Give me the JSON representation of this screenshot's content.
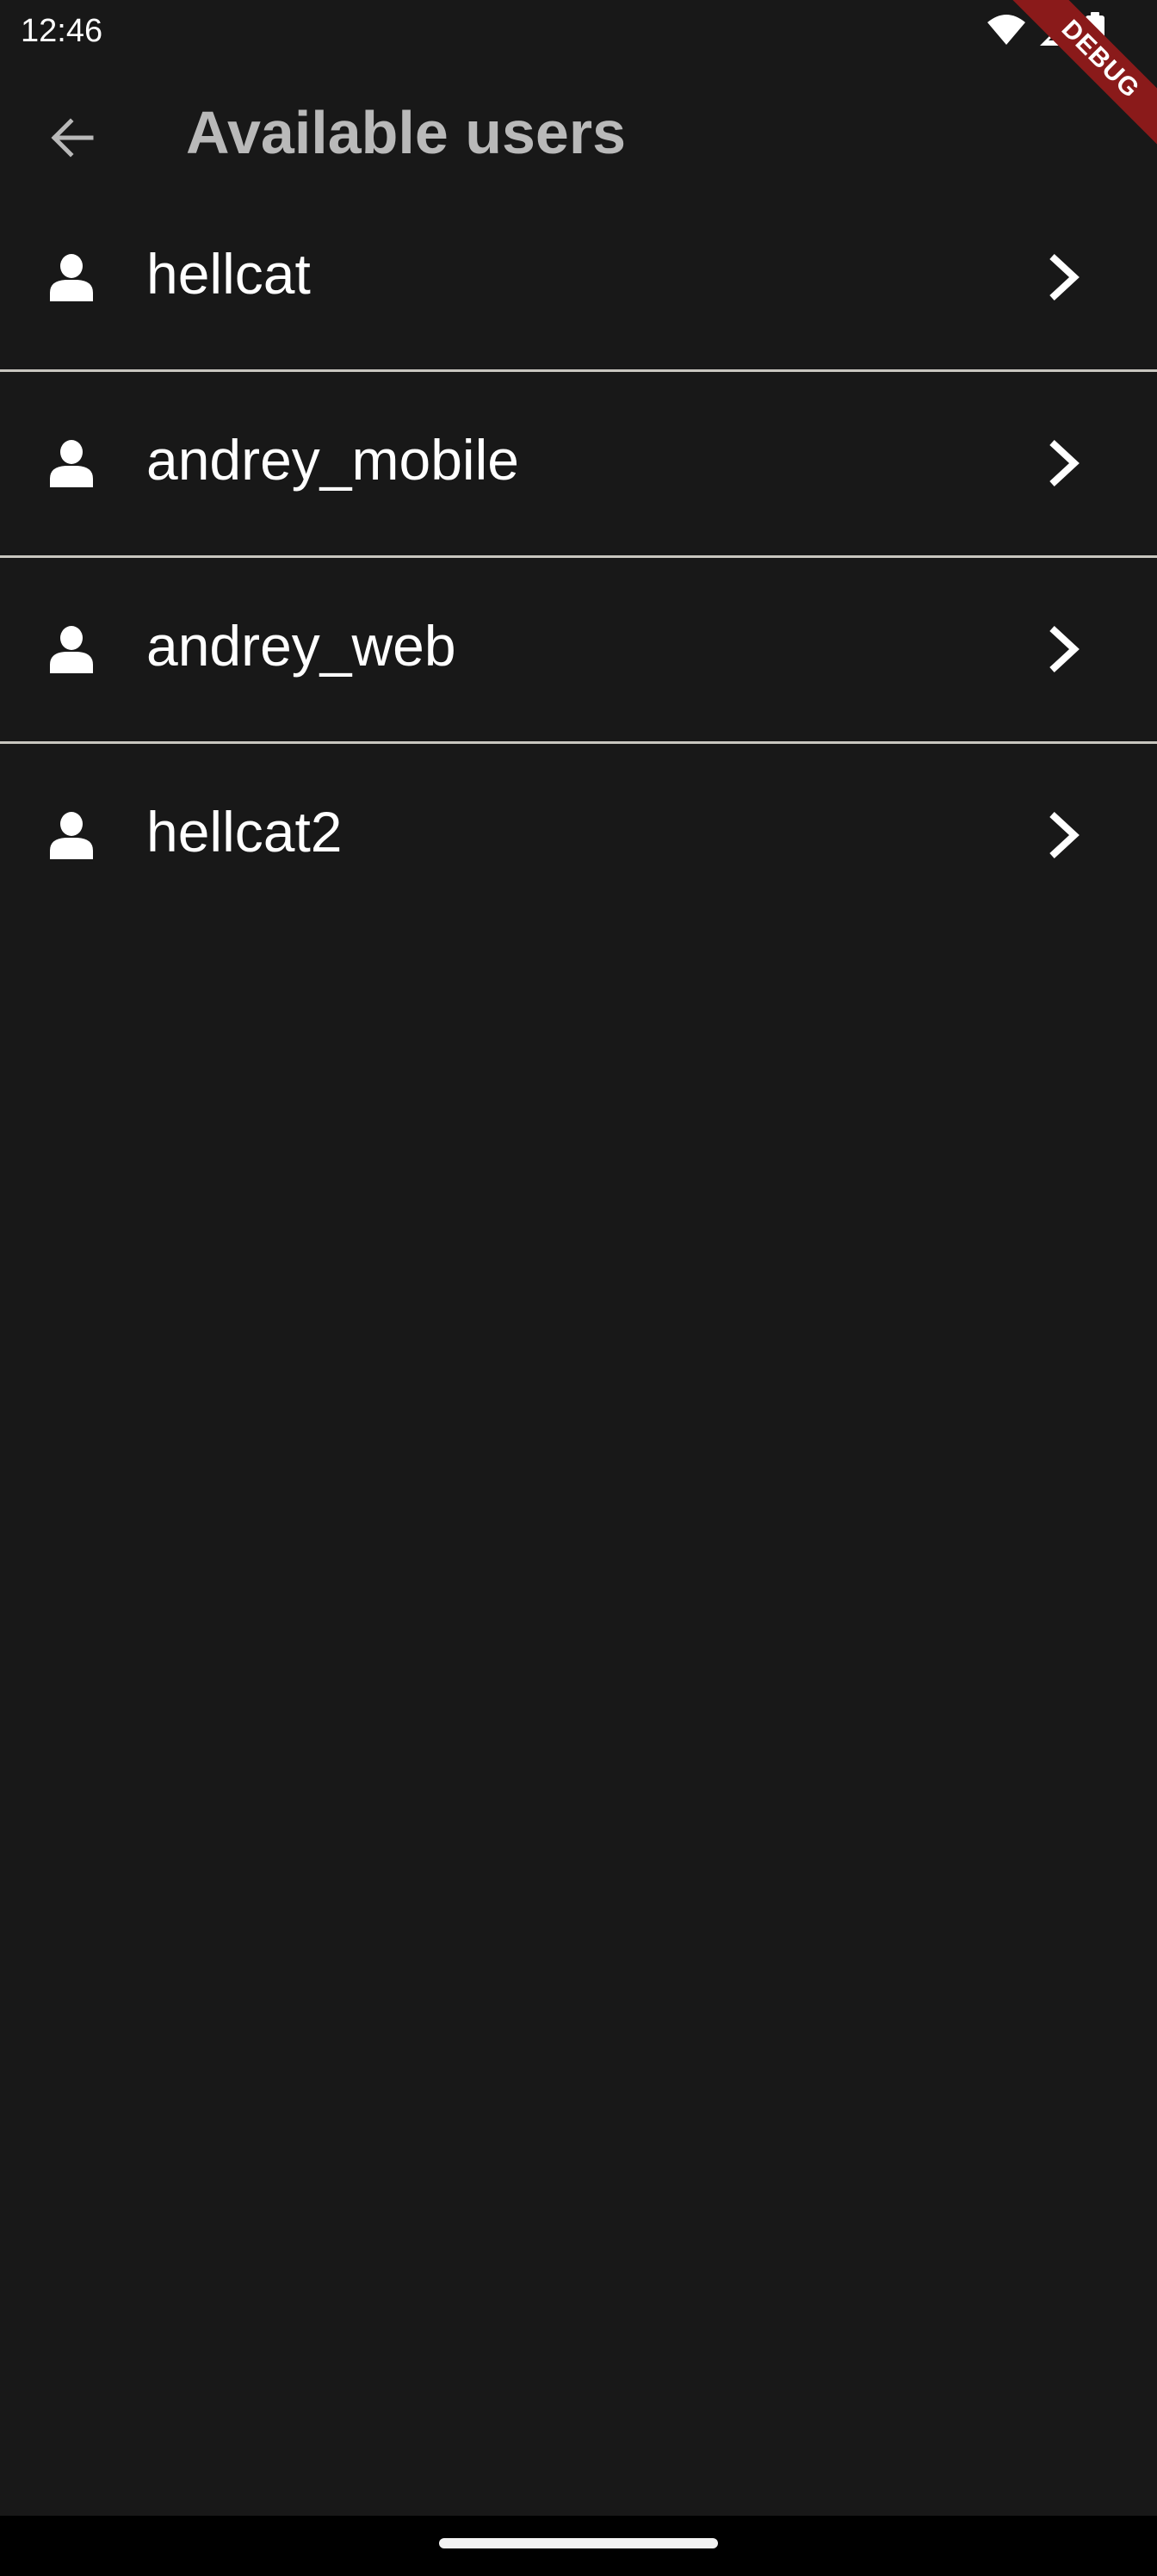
{
  "status_bar": {
    "time": "12:46",
    "icons": [
      "wifi-icon",
      "cellular-signal-icon",
      "battery-icon"
    ]
  },
  "debug_banner": {
    "label": "DEBUG"
  },
  "app_bar": {
    "back_icon": "arrow-back-icon",
    "title": "Available users"
  },
  "users": [
    {
      "label": "hellcat",
      "icon": "person-icon",
      "trailing_icon": "chevron-right-icon"
    },
    {
      "label": "andrey_mobile",
      "icon": "person-icon",
      "trailing_icon": "chevron-right-icon"
    },
    {
      "label": "andrey_web",
      "icon": "person-icon",
      "trailing_icon": "chevron-right-icon"
    },
    {
      "label": "hellcat2",
      "icon": "person-icon",
      "trailing_icon": "chevron-right-icon"
    }
  ],
  "colors": {
    "background": "#181818",
    "title": "#b9b9b9",
    "text": "#ffffff",
    "divider": "#c8c6bf",
    "debug_banner": "#8a1a1a",
    "nav_bar": "#000000"
  }
}
